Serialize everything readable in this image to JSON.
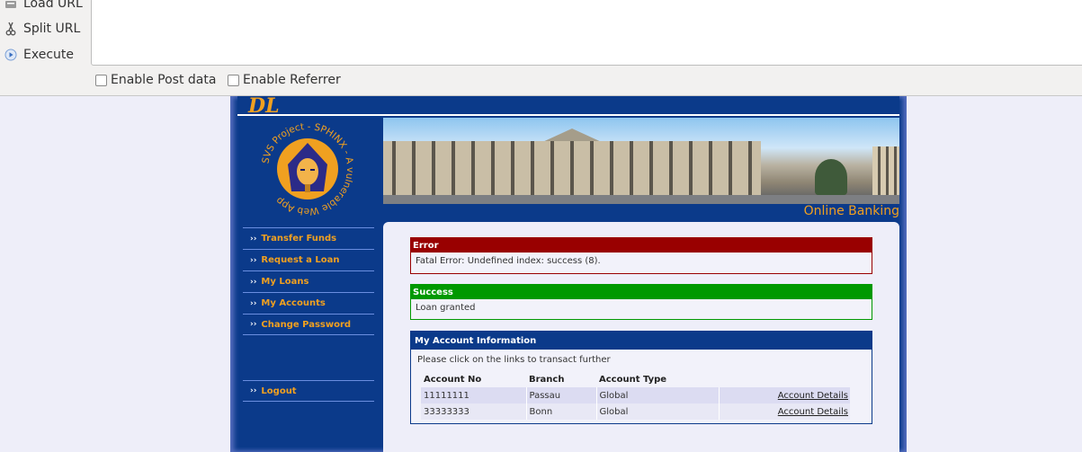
{
  "hackbar": {
    "buttons": [
      {
        "label": "Load URL",
        "icon": "load-url-icon"
      },
      {
        "label": "Split URL",
        "icon": "scissors-icon"
      },
      {
        "label": "Execute",
        "icon": "play-icon"
      }
    ],
    "url_value": "",
    "checks": [
      {
        "label": "Enable Post data",
        "checked": false
      },
      {
        "label": "Enable Referrer",
        "checked": false
      }
    ]
  },
  "site": {
    "brand_mark": "DL",
    "logo_text": "SVS Project - SPHINX - A vulnerable Web App",
    "tagline": "Online Banking"
  },
  "nav": {
    "items": [
      "Transfer Funds",
      "Request a Loan",
      "My Loans",
      "My Accounts",
      "Change Password"
    ],
    "logout": "Logout"
  },
  "messages": {
    "error": {
      "title": "Error",
      "text": "Fatal Error: Undefined index: success (8)."
    },
    "success": {
      "title": "Success",
      "text": "Loan granted"
    }
  },
  "account_info": {
    "title": "My Account Information",
    "instruction": "Please click on the links to transact further",
    "columns": [
      "Account No",
      "Branch",
      "Account Type"
    ],
    "rows": [
      {
        "account_no": "11111111",
        "branch": "Passau",
        "type": "Global",
        "link": "Account Details"
      },
      {
        "account_no": "33333333",
        "branch": "Bonn",
        "type": "Global",
        "link": "Account Details"
      }
    ]
  },
  "colors": {
    "frame": "#0b3a8a",
    "accent": "#f0a020",
    "error": "#990000",
    "success": "#009900"
  }
}
